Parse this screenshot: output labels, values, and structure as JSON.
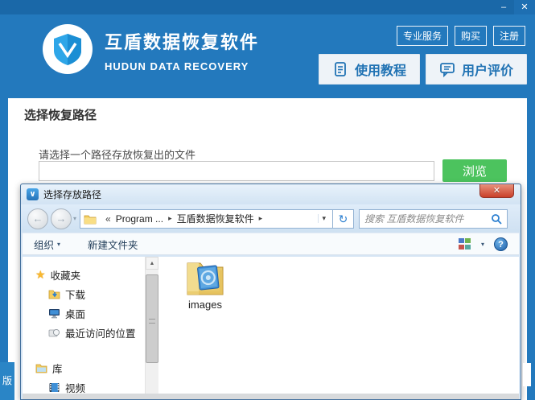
{
  "colors": {
    "header_blue": "#2379bd",
    "titlestrip_blue": "#1a68a8",
    "accent_green": "#4cc35e",
    "button_text_blue": "#2173b4",
    "close_red": "#c9402a",
    "star_gold": "#f8b830",
    "folder_yellow": "#efd47d"
  },
  "window": {
    "controls": {
      "minimize": "–",
      "close": "✕"
    },
    "brand": {
      "title": "互盾数据恢复软件",
      "subtitle": "HUDUN DATA RECOVERY"
    },
    "nav_links": [
      {
        "label": "专业服务"
      },
      {
        "label": "购买"
      },
      {
        "label": "注册"
      }
    ],
    "action_buttons": [
      {
        "label": "使用教程",
        "icon": "tutorial-document-icon"
      },
      {
        "label": "用户评价",
        "icon": "review-chat-icon"
      }
    ],
    "side_tab_label": "版"
  },
  "main": {
    "section_title": "选择恢复路径",
    "path_label": "请选择一个路径存放恢复出的文件",
    "path_value": "",
    "browse_button": "浏览"
  },
  "dialog": {
    "title": "选择存放路径",
    "close_glyph": "✕",
    "nav": {
      "back_glyph": "←",
      "forward_glyph": "→",
      "history_caret": "▾",
      "breadcrumb": {
        "overflow": "«",
        "separator": "▸",
        "segments": [
          {
            "label": "Program ..."
          },
          {
            "label": "互盾数据恢复软件"
          }
        ]
      },
      "address_caret": "▾",
      "refresh_glyph": "↻",
      "search_placeholder": "搜索 互盾数据恢复软件"
    },
    "toolbar": {
      "organize": "组织",
      "organize_caret": "▾",
      "new_folder": "新建文件夹",
      "views_caret": "▾",
      "help_glyph": "?"
    },
    "sidebar": {
      "items": [
        {
          "label": "收藏夹",
          "icon": "star-icon"
        },
        {
          "label": "下载",
          "icon": "downloads-folder-icon"
        },
        {
          "label": "桌面",
          "icon": "desktop-icon"
        },
        {
          "label": "最近访问的位置",
          "icon": "recent-places-icon"
        },
        {
          "label": "库",
          "icon": "libraries-folder-icon"
        },
        {
          "label": "视频",
          "icon": "videos-icon"
        }
      ]
    },
    "files": [
      {
        "name": "images",
        "icon": "image-folder-icon"
      }
    ],
    "scrollbar": {
      "up_arrow": "▲"
    }
  }
}
